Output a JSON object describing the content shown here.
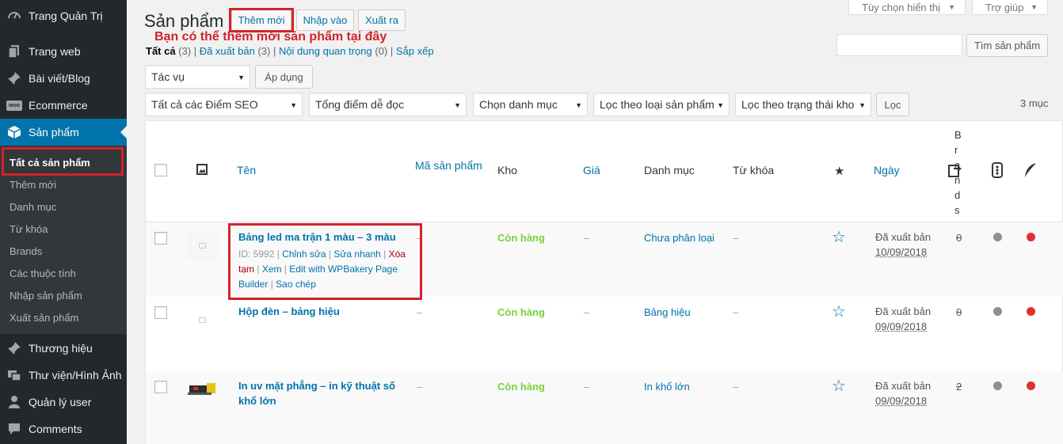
{
  "sidebar": {
    "items": [
      {
        "label": "Trang Quản Trị",
        "icon": "dashboard-icon"
      },
      {
        "label": "Trang web",
        "icon": "pages-icon"
      },
      {
        "label": "Bài viết/Blog",
        "icon": "pin-icon"
      },
      {
        "label": "Ecommerce",
        "icon": "woo-icon"
      },
      {
        "label": "Sản phẩm",
        "icon": "cube-icon"
      },
      {
        "label": "Thương hiệu",
        "icon": "pin-icon"
      },
      {
        "label": "Thư viện/Hình Ảnh",
        "icon": "media-icon"
      },
      {
        "label": "Quản lý user",
        "icon": "user-icon"
      },
      {
        "label": "Comments",
        "icon": "comment-icon"
      }
    ],
    "submenu": [
      "Tất cả sản phẩm",
      "Thêm mới",
      "Danh mục",
      "Từ khóa",
      "Brands",
      "Các thuộc tính",
      "Nhập sản phẩm",
      "Xuất sản phẩm"
    ]
  },
  "header": {
    "title": "Sản phẩm",
    "add_new": "Thêm mới",
    "import": "Nhập vào",
    "export": "Xuất ra",
    "hint": "Bạn có thể thêm mới sản phẩm tại đây",
    "screen_options": "Tùy chọn hiển thị",
    "help": "Trợ giúp"
  },
  "views": {
    "all": "Tất cả",
    "all_count": "(3)",
    "published": "Đã xuất bản",
    "published_count": "(3)",
    "important": "Nội dung quan trọng",
    "important_count": "(0)",
    "sort": "Sắp xếp"
  },
  "search": {
    "button": "Tìm sản phẩm",
    "value": ""
  },
  "bulk": {
    "action": "Tác vụ",
    "apply": "Áp dụng"
  },
  "filters": {
    "seo": "Tất cả các Điểm SEO",
    "readability": "Tổng điểm dễ đọc",
    "category": "Chọn danh mục",
    "type": "Lọc theo loại sản phẩm",
    "stock": "Lọc theo trạng thái kho",
    "filter_button": "Lọc",
    "count": "3 mục"
  },
  "columns": {
    "name": "Tên",
    "sku": "Mã sản phẩm",
    "stock": "Kho",
    "price": "Giá",
    "category": "Danh mục",
    "tags": "Từ khóa",
    "date": "Ngày",
    "brands": "B r a n d s"
  },
  "rows": [
    {
      "name": "Bảng led ma trận 1 màu – 3 màu",
      "id": "ID: 5992",
      "edit": "Chỉnh sửa",
      "quick_edit": "Sửa nhanh",
      "trash": "Xóa tạm",
      "view": "Xem",
      "wpbakery": "Edit with WPBakery Page Builder",
      "duplicate": "Sao chép",
      "sku": "–",
      "stock": "Còn hàng",
      "price": "–",
      "category": "Chưa phân loại",
      "tags": "–",
      "status": "Đã xuất bản",
      "date": "10/09/2018",
      "brands": "0",
      "dot_grey": "#8c8f94",
      "dot_red": "#dc3232"
    },
    {
      "name": "Hộp đèn – bảng hiệu",
      "sku": "–",
      "stock": "Còn hàng",
      "price": "–",
      "category": "Bảng hiệu",
      "tags": "–",
      "status": "Đã xuất bản",
      "date": "09/09/2018",
      "brands": "0"
    },
    {
      "name": "In uv mặt phẳng – in kỹ thuật số khổ lớn",
      "sku": "–",
      "stock": "Còn hàng",
      "price": "–",
      "category": "In khổ lớn",
      "tags": "–",
      "status": "Đã xuất bản",
      "date": "09/09/2018",
      "brands": "2"
    }
  ],
  "colors": {
    "accent": "#0073aa",
    "highlight": "#d2232a",
    "in_stock": "#7ad03a",
    "sidebar": "#23282d"
  }
}
